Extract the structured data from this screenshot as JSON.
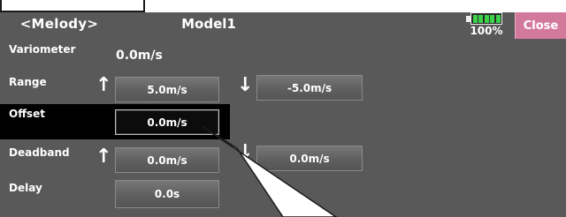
{
  "header": {
    "mode_title": "<Melody>",
    "model_title": "Model1",
    "battery_text": "100%",
    "close_label": "Close"
  },
  "rows": {
    "variometer": {
      "label": "Variometer",
      "value": "0.0m/s"
    },
    "range": {
      "label": "Range",
      "up_value": "5.0m/s",
      "down_value": "-5.0m/s"
    },
    "offset": {
      "label": "Offset",
      "value": "0.0m/s"
    },
    "deadband": {
      "label": "Deadband",
      "up_value": "0.0m/s",
      "down_value": "0.0m/s"
    },
    "delay": {
      "label": "Delay",
      "value": "0.0s"
    }
  },
  "icons": {
    "up_arrow": "up-arrow-icon",
    "down_arrow": "down-arrow-icon",
    "battery": "battery-icon"
  },
  "colors": {
    "background": "#595959",
    "close_button": "#d37a9c",
    "battery_level": "#3cd24a",
    "selected": "#000000"
  },
  "battery_level": 1.0
}
